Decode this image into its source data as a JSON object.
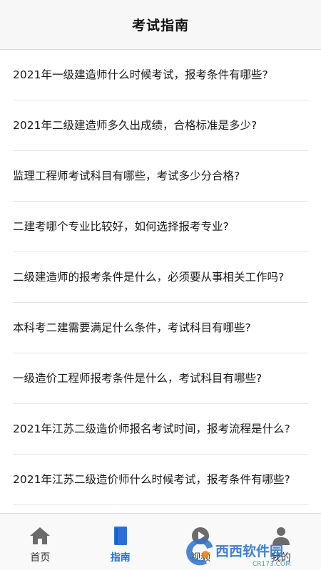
{
  "header": {
    "title": "考试指南"
  },
  "articles": [
    {
      "title": "2021年一级建造师什么时候考试，报考条件有哪些?"
    },
    {
      "title": "2021年二级建造师多久出成绩，合格标准是多少?"
    },
    {
      "title": "监理工程师考试科目有哪些，考试多少分合格?"
    },
    {
      "title": "二建考哪个专业比较好，如何选择报考专业?"
    },
    {
      "title": "二级建造师的报考条件是什么，必须要从事相关工作吗?"
    },
    {
      "title": "本科考二建需要满足什么条件，考试科目有哪些?"
    },
    {
      "title": "一级造价工程师报考条件是什么，考试科目有哪些?"
    },
    {
      "title": "2021年江苏二级造价师报名考试时间，报考流程是什么?"
    },
    {
      "title": "2021年江苏二级造价师什么时候考试，报考条件有哪些?"
    }
  ],
  "tabbar": {
    "tabs": [
      {
        "label": "首页",
        "icon": "home-icon",
        "active": false
      },
      {
        "label": "指南",
        "icon": "book-icon",
        "active": true
      },
      {
        "label": "视频",
        "icon": "video-icon",
        "active": false
      },
      {
        "label": "我的",
        "icon": "person-icon",
        "active": false
      }
    ]
  },
  "watermark": {
    "text": "西西软件园",
    "url_text": "CR173.COM"
  },
  "colors": {
    "accent": "#2b6fd6",
    "text": "#1a1a1a",
    "icon_gray": "#6b6b6b",
    "header_bg": "#f7f7f7"
  }
}
